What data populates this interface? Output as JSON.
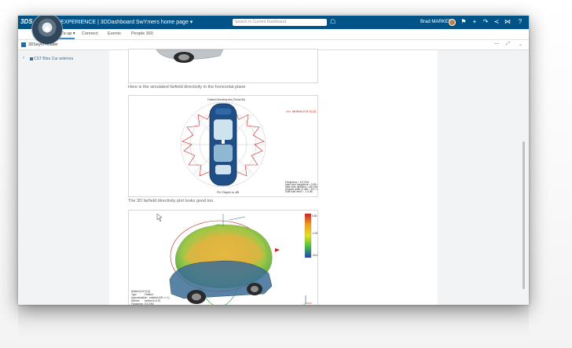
{
  "topbar": {
    "logo": "3DS",
    "app_prefix": "3D",
    "app_title": "EXPERIENCE | 3DDashboard SwYmers home page",
    "dropdown_icon": "chevron-down-icon",
    "search_placeholder": "Search in Current Dashboard",
    "user_name": "Brad MARKER",
    "icons": [
      "tag-icon",
      "bookmark-icon",
      "add-icon",
      "share-icon",
      "network-icon",
      "tools-icon",
      "help-icon"
    ]
  },
  "tabs": [
    {
      "label": "What's up",
      "active": true
    },
    {
      "label": "Connect",
      "active": false
    },
    {
      "label": "Events",
      "active": false
    },
    {
      "label": "People 360",
      "active": false
    }
  ],
  "widget": {
    "title": "3DSwym Reader"
  },
  "breadcrumb": {
    "label": "CST Bleu Car antenna"
  },
  "content": {
    "para1": "Here is the simulated farfield directivity in the horizontal plane",
    "para2": "The 3D farfield directivity plot looks good too."
  },
  "colors": {
    "topbar": "#005386",
    "accent": "#3b8ec2",
    "car": "#1f4f86",
    "polar_line": "#cc2222"
  }
}
